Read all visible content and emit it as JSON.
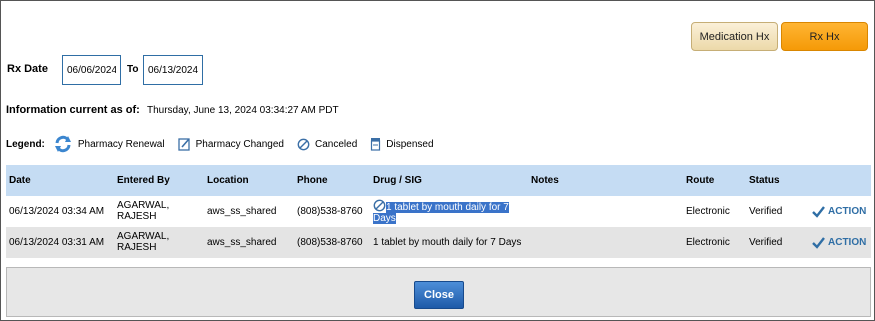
{
  "top_buttons": {
    "medication_hx": "Medication Hx",
    "rx_hx": "Rx Hx"
  },
  "filter": {
    "rx_date_label": "Rx Date",
    "from": "06/06/2024",
    "to_label": "To",
    "to": "06/13/2024"
  },
  "info": {
    "label": "Information current as of:",
    "value": "Thursday, June 13, 2024 03:34:27 AM PDT"
  },
  "legend": {
    "label": "Legend:",
    "items": [
      {
        "icon": "pharmacy-renewal-icon",
        "label": "Pharmacy Renewal"
      },
      {
        "icon": "pharmacy-changed-icon",
        "label": "Pharmacy Changed"
      },
      {
        "icon": "canceled-icon",
        "label": "Canceled"
      },
      {
        "icon": "dispensed-icon",
        "label": "Dispensed"
      }
    ]
  },
  "table": {
    "headers": [
      "Date",
      "Entered By",
      "Location",
      "Phone",
      "Drug / SIG",
      "Notes",
      "Route",
      "Status"
    ],
    "rows": [
      {
        "date": "06/13/2024 03:34 AM",
        "entered_by_1": "AGARWAL,",
        "entered_by_2": "RAJESH",
        "location": "aws_ss_shared",
        "phone": "(808)538-8760",
        "drug_sig_1": "1 tablet by mouth daily for 7",
        "drug_sig_2": "Days",
        "drug_icon": "canceled-icon",
        "notes": "",
        "route": "Electronic",
        "status": "Verified",
        "action": "ACTION"
      },
      {
        "date": "06/13/2024 03:31 AM",
        "entered_by_1": "AGARWAL,",
        "entered_by_2": "RAJESH",
        "location": "aws_ss_shared",
        "phone": "(808)538-8760",
        "drug_sig": "1 tablet by mouth daily for 7 Days",
        "notes": "",
        "route": "Electronic",
        "status": "Verified",
        "action": "ACTION"
      }
    ]
  },
  "footer": {
    "close": "Close"
  },
  "colors": {
    "header_bg": "#c5dcf3",
    "accent": "#2f6ea5",
    "rx_hx": "#f59a07",
    "close_btn": "#1e5aa8",
    "highlight": "#3a73c9"
  }
}
